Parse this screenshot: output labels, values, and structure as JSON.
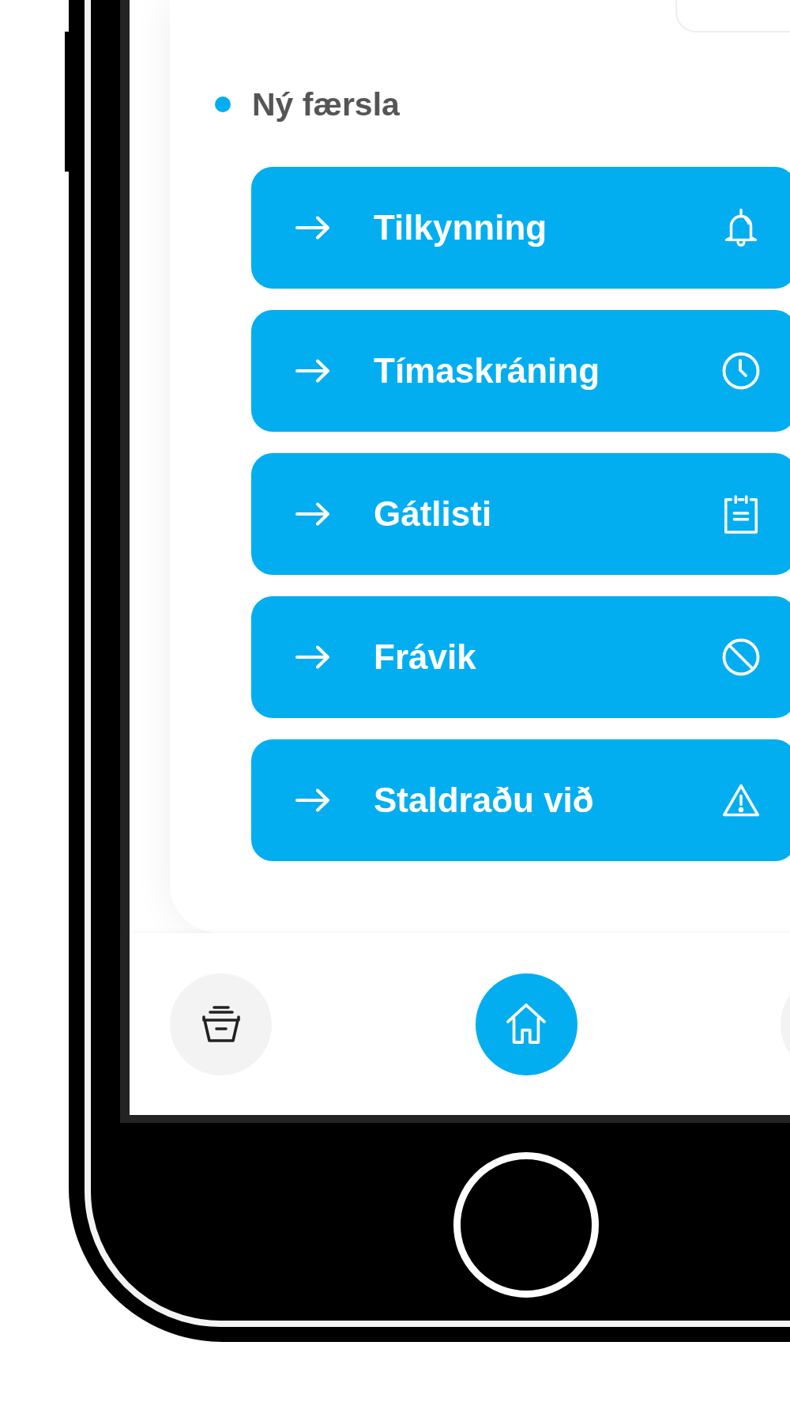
{
  "new_entry": {
    "title": "Ný færsla"
  },
  "actions": [
    {
      "label": "Tilkynning"
    },
    {
      "label": "Tímaskráning"
    },
    {
      "label": "Gátlisti"
    },
    {
      "label": "Frávik"
    },
    {
      "label": "Staldraðu við"
    }
  ],
  "bottom_nav": [
    {
      "selected": false
    },
    {
      "selected": true
    },
    {
      "selected": false
    }
  ]
}
